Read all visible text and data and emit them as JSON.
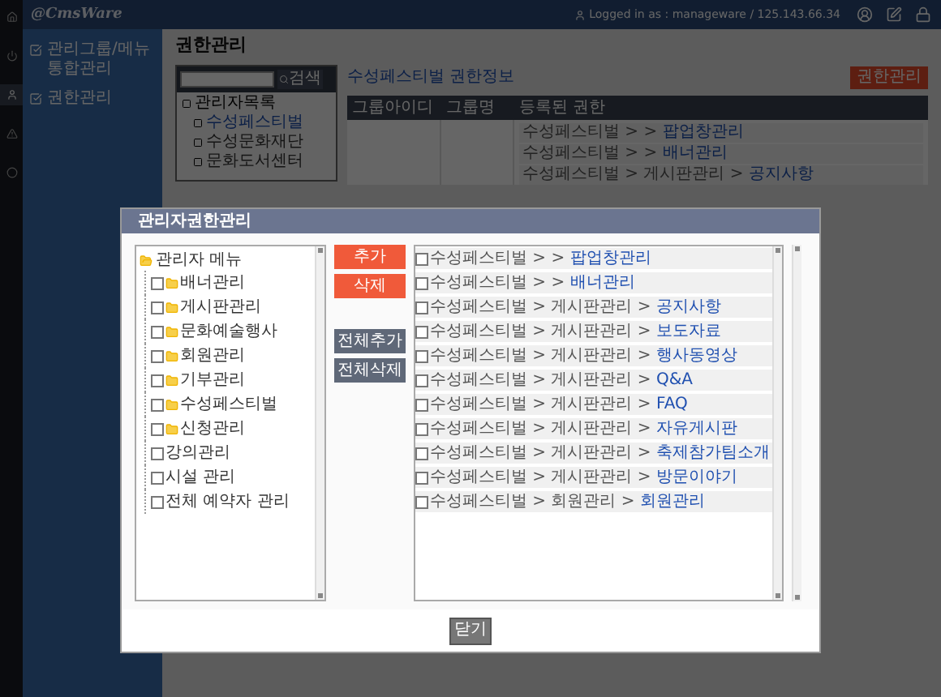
{
  "header": {
    "logo": "@CmsWare",
    "login_info": "Logged in as : manageware / 125.143.66.34"
  },
  "rail": [
    {
      "selected": false
    },
    {
      "selected": false
    },
    {
      "selected": true
    },
    {
      "selected": false
    },
    {
      "selected": false
    }
  ],
  "sidebar": {
    "items": [
      {
        "label": "관리그룹/메뉴 통합관리"
      },
      {
        "label": "권한관리"
      }
    ]
  },
  "page": {
    "title": "권한관리",
    "search": {
      "button": "검색"
    },
    "group_tree": {
      "root": "관리자목록",
      "children": [
        {
          "label": "수성페스티벌",
          "selected": true
        },
        {
          "label": "수성문화재단",
          "selected": false
        },
        {
          "label": "문화도서센터",
          "selected": false
        }
      ]
    },
    "info_title": "수성페스티벌 권한정보",
    "manage_button": "권한관리",
    "table": {
      "columns": [
        "그룹아이디",
        "그룹명",
        "등록된 권한"
      ],
      "permissions": [
        {
          "path": "수성페스티벌 > > ",
          "menu": "팝업창관리"
        },
        {
          "path": "수성페스티벌 > > ",
          "menu": "배너관리"
        },
        {
          "path": "수성페스티벌 > 게시판관리 > ",
          "menu": "공지사항"
        }
      ]
    }
  },
  "dialog": {
    "title": "관리자권한관리",
    "menu_tree": {
      "root": "관리자 메뉴",
      "children": [
        {
          "label": "배너관리",
          "kind": "folder",
          "checked": false
        },
        {
          "label": "게시판관리",
          "kind": "folder",
          "checked": false
        },
        {
          "label": "문화예술행사",
          "kind": "folder",
          "checked": false
        },
        {
          "label": "회원관리",
          "kind": "folder",
          "checked": false
        },
        {
          "label": "기부관리",
          "kind": "folder",
          "checked": false
        },
        {
          "label": "수성페스티벌",
          "kind": "folder",
          "checked": false
        },
        {
          "label": "신청관리",
          "kind": "folder",
          "checked": false
        },
        {
          "label": "강의관리",
          "kind": "page",
          "checked": false
        },
        {
          "label": "시설 관리",
          "kind": "page",
          "checked": false
        },
        {
          "label": "전체 예약자 관리",
          "kind": "page",
          "checked": false
        }
      ]
    },
    "buttons": [
      {
        "label": "추가",
        "kind": "primary"
      },
      {
        "label": "삭제",
        "kind": "primary"
      },
      {
        "label": "전체추가",
        "kind": "secondary"
      },
      {
        "label": "전체삭제",
        "kind": "secondary"
      }
    ],
    "assigned": [
      {
        "path": "수성페스티벌 > > ",
        "menu": "팝업창관리",
        "checked": false
      },
      {
        "path": "수성페스티벌 > > ",
        "menu": "배너관리",
        "checked": false
      },
      {
        "path": "수성페스티벌 > 게시판관리 > ",
        "menu": "공지사항",
        "checked": false
      },
      {
        "path": "수성페스티벌 > 게시판관리 > ",
        "menu": "보도자료",
        "checked": false
      },
      {
        "path": "수성페스티벌 > 게시판관리 > ",
        "menu": "행사동영상",
        "checked": false
      },
      {
        "path": "수성페스티벌 > 게시판관리 > ",
        "menu": "Q&A",
        "checked": false
      },
      {
        "path": "수성페스티벌 > 게시판관리 > ",
        "menu": "FAQ",
        "checked": false
      },
      {
        "path": "수성페스티벌 > 게시판관리 > ",
        "menu": "자유게시판",
        "checked": false
      },
      {
        "path": "수성페스티벌 > 게시판관리 > ",
        "menu": "축제참가팀소개",
        "checked": false
      },
      {
        "path": "수성페스티벌 > 게시판관리 > ",
        "menu": "방문이야기",
        "checked": false
      },
      {
        "path": "수성페스티벌 > 회원관리 > ",
        "menu": "회원관리",
        "checked": false
      }
    ],
    "close_button": "닫기"
  }
}
